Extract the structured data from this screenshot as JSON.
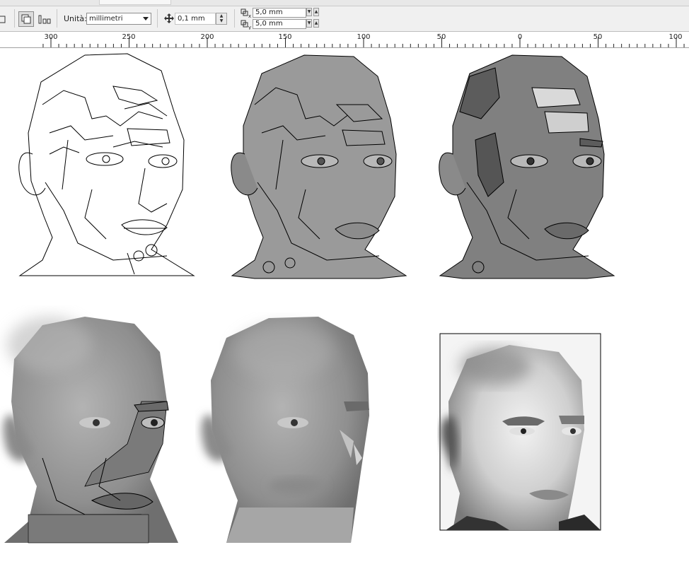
{
  "toolbar": {
    "units_label": "Unità:",
    "units_value": "millimetri",
    "nudge_value": "0,1 mm",
    "dup_x_value": "5,0 mm",
    "dup_y_value": "5,0 mm",
    "dup_x_label": "x",
    "dup_y_label": "y"
  },
  "ruler": {
    "labels": [
      "300",
      "250",
      "200",
      "150",
      "100",
      "50",
      "0",
      "50",
      "100"
    ]
  },
  "icons": [
    "rectangle-icon",
    "duplicate-object-icon",
    "align-icon",
    "nudge-icon",
    "duplicate-x-icon",
    "duplicate-y-icon",
    "dropdown-arrow-icon",
    "spin-up-icon",
    "spin-down-icon"
  ],
  "colors": {
    "toolbar_bg": "#f0f0f0",
    "fill_mid": "#9a9a9a",
    "fill_dark": "#7f7f7f",
    "skin_light": "#a6a6a6"
  }
}
